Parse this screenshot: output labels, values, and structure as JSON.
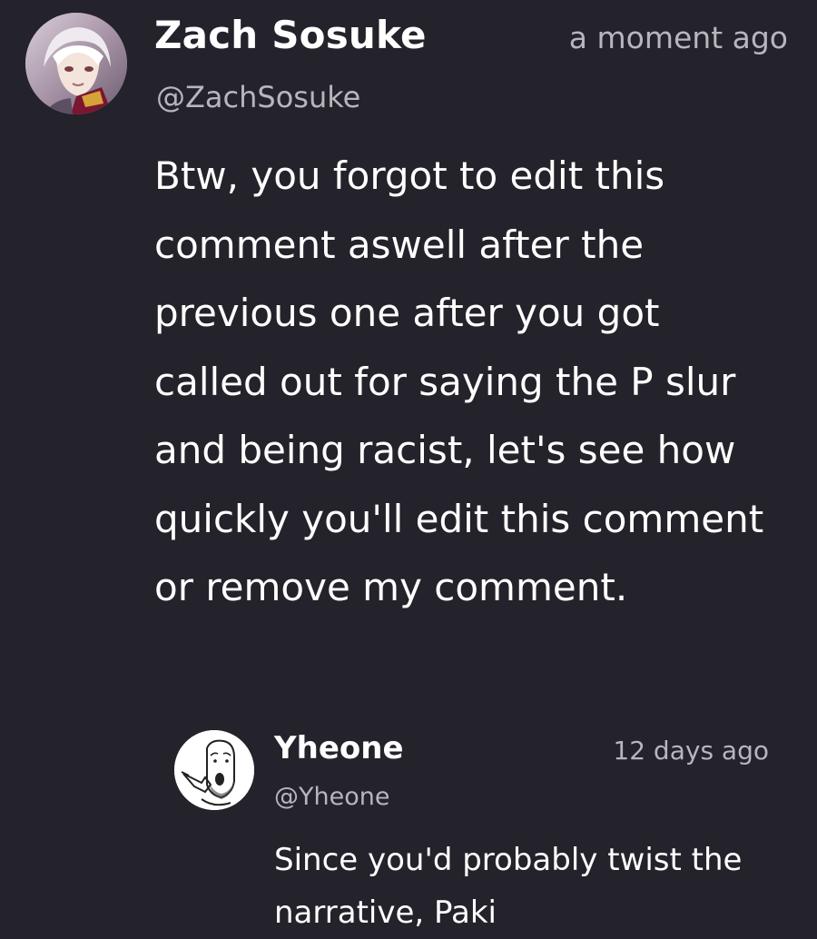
{
  "comment": {
    "author_name": "Zach Sosuke",
    "author_handle": "@ZachSosuke",
    "timestamp": "a moment ago",
    "avatar_icon": "anime-character-avatar",
    "body": "Btw, you forgot to edit this comment aswell after the previous one after you got called out for saying the P slur and being racist, let's see how quickly you'll edit this comment or remove my comment."
  },
  "reply": {
    "author_name": "Yheone",
    "author_handle": "@Yheone",
    "timestamp": "12 days ago",
    "avatar_icon": "wojak-pointing-avatar",
    "body": "Since you'd probably twist the narrative, Paki"
  },
  "colors": {
    "background": "#24222a",
    "primary_text": "#ffffff",
    "secondary_text": "#b7b5bd"
  }
}
